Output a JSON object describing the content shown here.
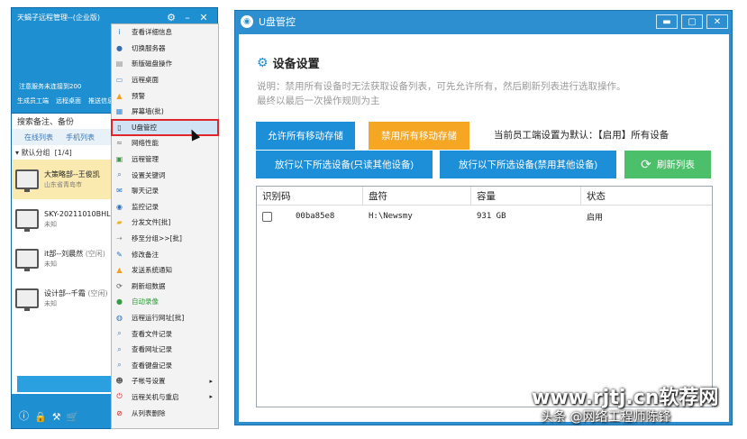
{
  "left_app": {
    "title": "天蝎子远程管理--(企业版)",
    "status_text": "注意服务未连接到200",
    "tools": [
      "生成员工端",
      "远程桌面",
      "推送信息"
    ],
    "search_value": "搜索备注、备份",
    "tabs": [
      "在线列表",
      "手机列表"
    ],
    "group_label": "默认分组",
    "group_count": "[1/4]",
    "clients": [
      {
        "name": "大策略部--王俊凯",
        "sub": "山东省青岛市",
        "selected": true
      },
      {
        "name": "SKY-20211010BHL",
        "sub": "未知",
        "selected": false
      },
      {
        "name": "it部--刘晨然",
        "tag": "(空闲)",
        "sub": "未知",
        "selected": false
      },
      {
        "name": "设计部--千霜",
        "tag": "(空闲)",
        "sub": "未知",
        "selected": false
      }
    ]
  },
  "context_menu": {
    "items": [
      {
        "label": "查看详细信息",
        "icon": "info-icon",
        "color": "#2a7fd4"
      },
      {
        "label": "切换服务器",
        "icon": "server-icon",
        "color": "#3b6ea8"
      },
      {
        "label": "新版磁盘操作",
        "icon": "disk-icon",
        "color": "#888888"
      },
      {
        "label": "远程桌面",
        "icon": "monitor-icon",
        "color": "#4a8cd8"
      },
      {
        "label": "预警",
        "icon": "warning-icon",
        "color": "#f0a020"
      },
      {
        "label": "屏幕墙(批)",
        "icon": "screen-wall-icon",
        "color": "#3a88d0"
      },
      {
        "label": "U盘管控",
        "icon": "usb-icon",
        "color": "#333333",
        "highlight": true
      },
      {
        "label": "网络性能",
        "icon": "network-icon",
        "color": "#777777"
      },
      {
        "label": "远程管理",
        "icon": "remote-icon",
        "color": "#3a9a48"
      },
      {
        "label": "设置关键词",
        "icon": "keyword-icon",
        "color": "#2a70c0"
      },
      {
        "label": "聊天记录",
        "icon": "chat-icon",
        "color": "#2a70c0"
      },
      {
        "label": "监控记录",
        "icon": "record-icon",
        "color": "#2a70c0"
      },
      {
        "label": "分发文件[批]",
        "icon": "folder-icon",
        "color": "#e8b020"
      },
      {
        "label": "移至分组>>[批]",
        "icon": "move-icon",
        "color": "#888888"
      },
      {
        "label": "修改备注",
        "icon": "edit-icon",
        "color": "#2a70c0"
      },
      {
        "label": "发送系统通知",
        "icon": "notice-icon",
        "color": "#f0a020"
      },
      {
        "label": "刷新组数据",
        "icon": "refresh-icon",
        "color": "#555555"
      },
      {
        "label": "自动录像",
        "icon": "camera-icon",
        "color": "#3a9a48",
        "green": true
      },
      {
        "label": "远程运行网址[批]",
        "icon": "globe-icon",
        "color": "#3070b0"
      },
      {
        "label": "查看文件记录",
        "icon": "search-icon",
        "color": "#2a80d0"
      },
      {
        "label": "查看网址记录",
        "icon": "search-icon",
        "color": "#2a80d0"
      },
      {
        "label": "查看键盘记录",
        "icon": "search-icon",
        "color": "#2a80d0"
      },
      {
        "label": "子帐号设置",
        "icon": "sub-account-icon",
        "color": "#5a5a5a",
        "arrow": true
      },
      {
        "label": "远程关机与重启",
        "icon": "power-icon",
        "color": "#d02020",
        "arrow": true
      },
      {
        "label": "从列表删除",
        "icon": "delete-icon",
        "color": "#d02020"
      }
    ]
  },
  "dialog": {
    "title": "U盘管控",
    "section_title": "设备设置",
    "description_line1": "说明：禁用所有设备时无法获取设备列表，可先允许所有，然后刷新列表进行选取操作。",
    "description_line2": "最终以最后一次操作规则为主",
    "allow_all_label": "允许所有移动存储",
    "disable_all_label": "禁用所有移动存储",
    "current_setting": "当前员工端设置为默认：【启用】所有设备",
    "allow_readonly_label": "放行以下所选设备(只读其他设备)",
    "allow_disable_label": "放行以下所选设备(禁用其他设备)",
    "refresh_label": "刷新列表",
    "columns": [
      "识别码",
      "盘符",
      "容量",
      "状态"
    ],
    "rows": [
      {
        "id": "00ba85e8",
        "drive": "H:\\Newsmy",
        "capacity": "931 GB",
        "status": "启用"
      }
    ]
  },
  "watermark": {
    "line1": "www.rjtj.cn软荐网",
    "line2": "头条 @网络工程师陈锋"
  }
}
